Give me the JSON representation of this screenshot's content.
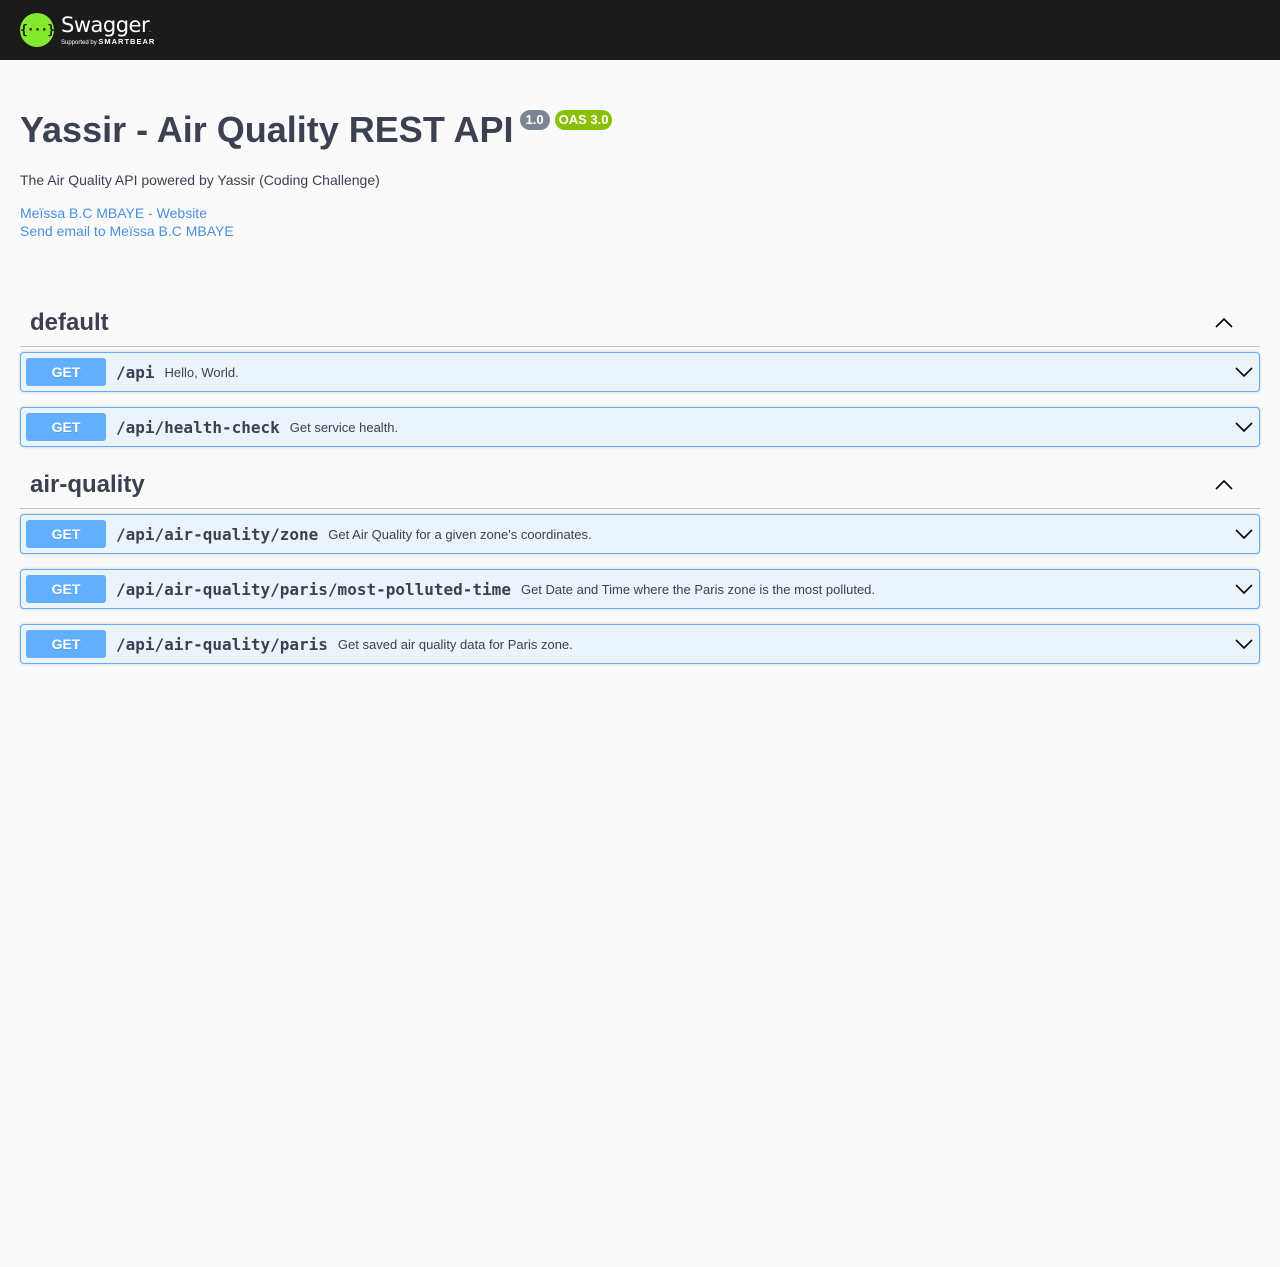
{
  "topbar": {
    "brand_name": "Swagger",
    "brand_tm": ".",
    "brand_sub_prefix": "Supported by ",
    "brand_sub_name": "SMARTBEAR",
    "logo_glyph": "{···}"
  },
  "info": {
    "title": "Yassir - Air Quality REST API",
    "version": "1.0",
    "oas": "OAS 3.0",
    "description": "The Air Quality API powered by Yassir (Coding Challenge)",
    "links": [
      "Meïssa B.C MBAYE - Website",
      "Send email to Meïssa B.C MBAYE"
    ]
  },
  "sections": [
    {
      "name": "default",
      "ops": [
        {
          "method": "GET",
          "path": "/api",
          "summary": "Hello, World."
        },
        {
          "method": "GET",
          "path": "/api/health-check",
          "summary": "Get service health."
        }
      ]
    },
    {
      "name": "air-quality",
      "ops": [
        {
          "method": "GET",
          "path": "/api/air-quality/zone",
          "summary": "Get Air Quality for a given zone's coordinates."
        },
        {
          "method": "GET",
          "path": "/api/air-quality/paris/most-polluted-time",
          "summary": "Get Date and Time where the Paris zone is the most polluted."
        },
        {
          "method": "GET",
          "path": "/api/air-quality/paris",
          "summary": "Get saved air quality data for Paris zone."
        }
      ]
    }
  ],
  "colors": {
    "topbar": "#1b1b1b",
    "logo": "#85ea2d",
    "get": "#61affe",
    "get_bg": "#ebf3fb",
    "link": "#4990e2",
    "version_badge": "#7d8492",
    "oas_badge": "#89bf04"
  },
  "icons": {
    "section_toggle": "chevron-up-icon",
    "op_toggle": "chevron-down-icon"
  }
}
